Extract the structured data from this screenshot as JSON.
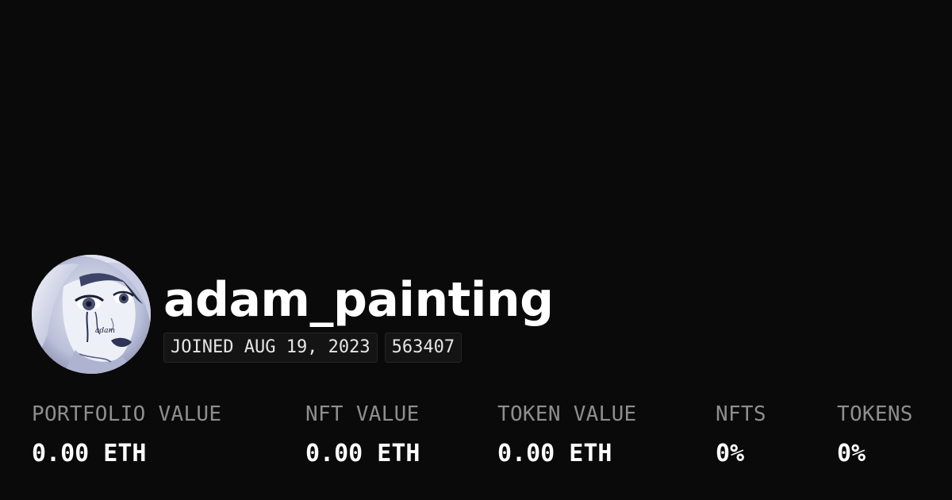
{
  "profile": {
    "username": "adam_painting",
    "joined": "JOINED AUG 19, 2023",
    "id": "563407",
    "avatar_signature": "adam"
  },
  "stats": [
    {
      "label": "PORTFOLIO VALUE",
      "value": "0.00 ETH"
    },
    {
      "label": "NFT VALUE",
      "value": "0.00 ETH"
    },
    {
      "label": "TOKEN VALUE",
      "value": "0.00 ETH"
    },
    {
      "label": "NFTS",
      "value": "0%"
    },
    {
      "label": "TOKENS",
      "value": "0%"
    }
  ],
  "colors": {
    "background": "#0a0a0a",
    "text": "#ffffff",
    "muted": "#8e8e8e",
    "badge_bg": "#141414"
  }
}
